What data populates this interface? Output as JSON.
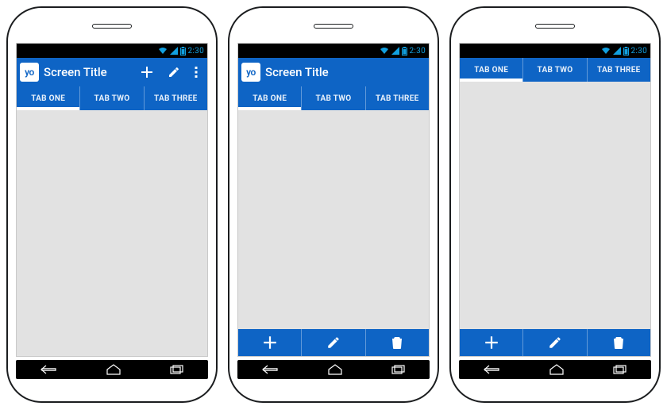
{
  "status": {
    "clock": "2:30"
  },
  "app_icon_text": "yo",
  "screen_title": "Screen Title",
  "tabs": [
    "TAB ONE",
    "TAB TWO",
    "TAB THREE"
  ],
  "selected_tab_index": 0,
  "phones": [
    {
      "show_actionbar": true,
      "show_actionbar_actions": true,
      "show_toolbar": false
    },
    {
      "show_actionbar": true,
      "show_actionbar_actions": false,
      "show_toolbar": true
    },
    {
      "show_actionbar": false,
      "show_actionbar_actions": false,
      "show_toolbar": true
    }
  ],
  "actionbar_actions": [
    "plus-icon",
    "pencil-icon",
    "overflow-icon"
  ],
  "toolbar_actions": [
    "plus-icon",
    "pencil-icon",
    "trash-icon"
  ]
}
